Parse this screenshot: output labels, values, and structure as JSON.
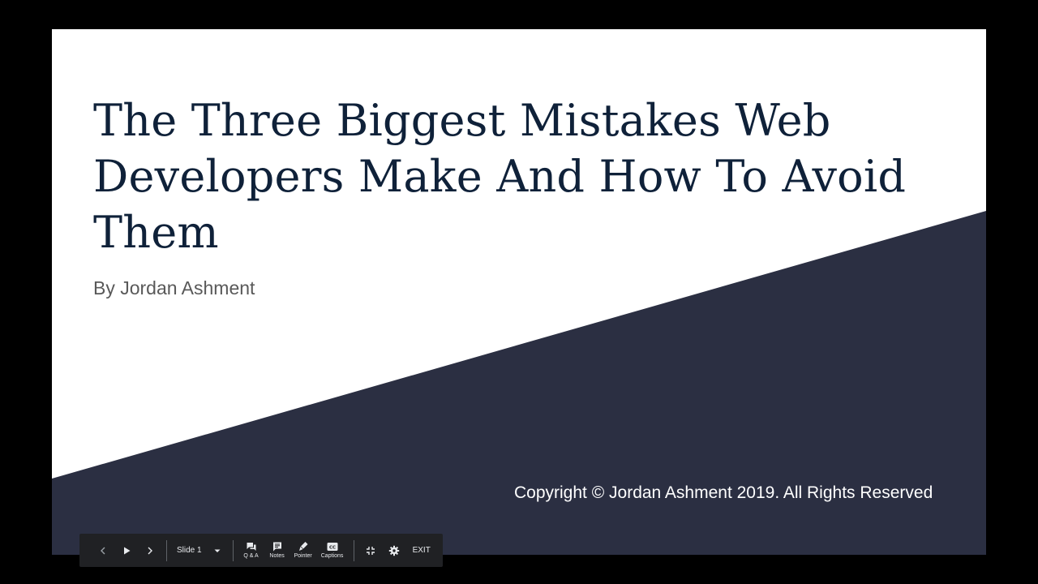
{
  "slide": {
    "title": "The Three Biggest Mistakes Web Developers Make And How To Avoid Them",
    "subtitle": "By Jordan Ashment",
    "copyright": "Copyright © Jordan Ashment 2019.  All Rights Reserved"
  },
  "toolbar": {
    "slide_select_label": "Slide 1",
    "qa_label": "Q & A",
    "notes_label": "Notes",
    "pointer_label": "Pointer",
    "captions_label": "Captions",
    "captions_glyph": "CC",
    "exit_label": "EXIT",
    "icons": [
      "chevron-left-icon",
      "play-icon",
      "chevron-right-icon",
      "caret-down-icon",
      "qa-icon",
      "notes-icon",
      "pointer-icon",
      "captions-icon",
      "exit-fullscreen-icon",
      "gear-icon"
    ]
  },
  "colors": {
    "backdrop": "#000000",
    "slide_background": "#ffffff",
    "slide_accent_band": "#2b2f42",
    "title_text": "#0f2139",
    "subtitle_text": "#595959",
    "toolbar_background": "#202124"
  }
}
